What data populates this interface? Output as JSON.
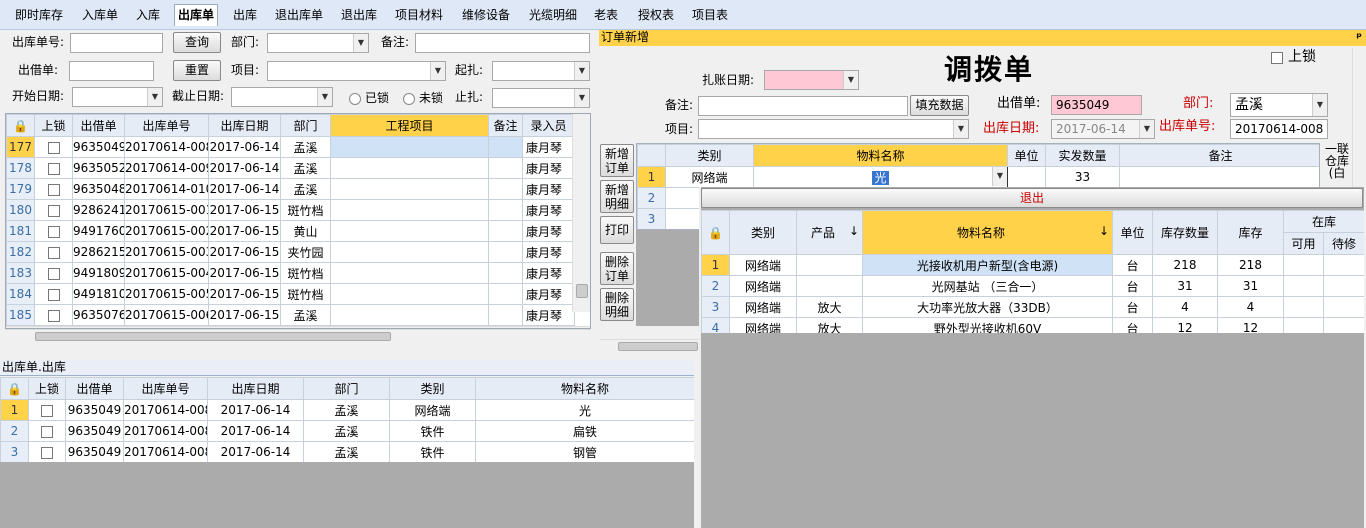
{
  "menu": [
    "即时库存",
    "入库单",
    "入库",
    "出库单",
    "出库",
    "退出库单",
    "退出库",
    "项目材料",
    "维修设备",
    "光缆明细",
    "老表",
    "授权表",
    "项目表"
  ],
  "menu_active": "出库单",
  "filters": {
    "out_no_label": "出库单号:",
    "query_btn": "查询",
    "dept_label": "部门:",
    "note_label": "备注:",
    "borrow_label": "出借单:",
    "reset_btn": "重置",
    "project_label": "项目:",
    "start_tie_label": "起扎:",
    "start_date_label": "开始日期:",
    "end_date_label": "截止日期:",
    "locked_label": "已锁",
    "unlocked_label": "未锁",
    "end_tie_label": "止扎:"
  },
  "main_grid": {
    "columns": [
      "上锁",
      "出借单",
      "出库单号",
      "出库日期",
      "部门",
      "工程项目",
      "备注",
      "录入员"
    ],
    "rows": [
      {
        "rn": "177",
        "borrow": "9635049",
        "no": "20170614-008",
        "date": "2017-06-14",
        "dept": "孟溪",
        "user": "康月琴"
      },
      {
        "rn": "178",
        "borrow": "9635052",
        "no": "20170614-009",
        "date": "2017-06-14",
        "dept": "孟溪",
        "user": "康月琴"
      },
      {
        "rn": "179",
        "borrow": "9635048",
        "no": "20170614-010",
        "date": "2017-06-14",
        "dept": "孟溪",
        "user": "康月琴"
      },
      {
        "rn": "180",
        "borrow": "9286241",
        "no": "20170615-001",
        "date": "2017-06-15",
        "dept": "斑竹档",
        "user": "康月琴"
      },
      {
        "rn": "181",
        "borrow": "9491760",
        "no": "20170615-002",
        "date": "2017-06-15",
        "dept": "黄山",
        "user": "康月琴"
      },
      {
        "rn": "182",
        "borrow": "9286215",
        "no": "20170615-003",
        "date": "2017-06-15",
        "dept": "夹竹园",
        "user": "康月琴"
      },
      {
        "rn": "183",
        "borrow": "9491809",
        "no": "20170615-004",
        "date": "2017-06-15",
        "dept": "斑竹档",
        "user": "康月琴"
      },
      {
        "rn": "184",
        "borrow": "9491810",
        "no": "20170615-005",
        "date": "2017-06-15",
        "dept": "斑竹档",
        "user": "康月琴"
      },
      {
        "rn": "185",
        "borrow": "9635076",
        "no": "20170615-006",
        "date": "2017-06-15",
        "dept": "孟溪",
        "user": "康月琴"
      }
    ]
  },
  "detail": {
    "title": "出库单.出库",
    "columns": [
      "上锁",
      "出借单",
      "出库单号",
      "出库日期",
      "部门",
      "类别",
      "物料名称"
    ],
    "rows": [
      {
        "rn": "1",
        "borrow": "9635049",
        "no": "20170614-008",
        "date": "2017-06-14",
        "dept": "孟溪",
        "cat": "网络端",
        "name": "光"
      },
      {
        "rn": "2",
        "borrow": "9635049",
        "no": "20170614-008",
        "date": "2017-06-14",
        "dept": "孟溪",
        "cat": "铁件",
        "name": "扁铁"
      },
      {
        "rn": "3",
        "borrow": "9635049",
        "no": "20170614-008",
        "date": "2017-06-14",
        "dept": "孟溪",
        "cat": "铁件",
        "name": "钢管"
      }
    ]
  },
  "order": {
    "panel_title": "订单新增",
    "pin": "ᵖ",
    "title": "调拨单",
    "lock_label": "上锁",
    "tie_date_label": "扎账日期:",
    "note_label": "备注:",
    "fill_btn": "填充数据",
    "borrow_label": "出借单:",
    "borrow_value": "9635049",
    "dept_label": "部门:",
    "dept_value": "孟溪",
    "project_label": "项目:",
    "date_label": "出库日期:",
    "date_value": "2017-06-14",
    "no_label": "出库单号:",
    "no_value": "20170614-008",
    "side_buttons": [
      [
        "新增",
        "订单"
      ],
      [
        "新增",
        "明细"
      ],
      [
        "打印"
      ],
      [
        "删除",
        "订单"
      ],
      [
        "删除",
        "明细"
      ]
    ],
    "grid_columns": [
      "类别",
      "物料名称",
      "单位",
      "实发数量",
      "备注"
    ],
    "grid_rows": [
      {
        "rn": "1",
        "cat": "网络端",
        "name": "光",
        "unit": "",
        "qty": "33"
      },
      {
        "rn": "2"
      },
      {
        "rn": "3"
      }
    ],
    "right_cut": [
      "一联",
      "仓库",
      "(白"
    ]
  },
  "popup": {
    "exit_btn": "退出",
    "columns": [
      "类别",
      "产品",
      "物料名称",
      "单位",
      "库存数量",
      "库存"
    ],
    "in_stock": "在库",
    "avail": "可用",
    "repair": "待修",
    "rows": [
      {
        "rn": "1",
        "cat": "网络端",
        "prod": "",
        "name": "光接收机用户新型(含电源)",
        "unit": "台",
        "qty": "218",
        "stock": "218"
      },
      {
        "rn": "2",
        "cat": "网络端",
        "prod": "",
        "name": "光网基站 （三合一）",
        "unit": "台",
        "qty": "31",
        "stock": "31"
      },
      {
        "rn": "3",
        "cat": "网络端",
        "prod": "放大",
        "name": "大功率光放大器（33DB）",
        "unit": "台",
        "qty": "4",
        "stock": "4"
      },
      {
        "rn": "4",
        "cat": "网络端",
        "prod": "放大",
        "name": "野外型光接收机60V",
        "unit": "台",
        "qty": "12",
        "stock": "12"
      }
    ]
  }
}
